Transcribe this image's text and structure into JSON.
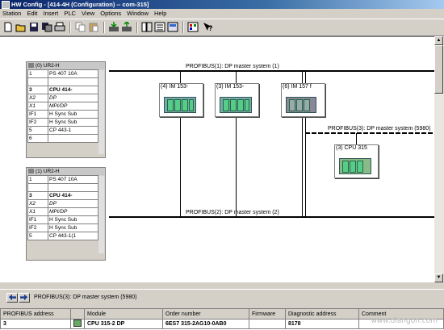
{
  "window": {
    "title": "HW Config - [414-4H (Configuration) -- com-315]"
  },
  "menu": [
    "Station",
    "Edit",
    "Insert",
    "PLC",
    "View",
    "Options",
    "Window",
    "Help"
  ],
  "toolbar_icons": [
    "new-icon",
    "open-icon",
    "save-icon",
    "save-compile-icon",
    "print-icon",
    "copy-icon",
    "paste-icon",
    "download-icon",
    "upload-icon",
    "catalog-icon",
    "network-icon",
    "settings-icon",
    "help-icon"
  ],
  "racks": [
    {
      "title": "(0) UR2-H",
      "rows": [
        {
          "slot": "1",
          "module": "PS 407 10A"
        },
        {
          "slot": "",
          "module": ""
        },
        {
          "slot": "3",
          "module": "CPU 414-"
        },
        {
          "slot": "X2",
          "module": "DP"
        },
        {
          "slot": "X1",
          "module": "MPI/DP"
        },
        {
          "slot": "IF1",
          "module": "H Sync Sub"
        },
        {
          "slot": "IF2",
          "module": "H Sync Sub"
        },
        {
          "slot": "5",
          "module": "CP 443-1"
        },
        {
          "slot": "6",
          "module": ""
        }
      ]
    },
    {
      "title": "(1) UR2-H",
      "rows": [
        {
          "slot": "1",
          "module": "PS 407 10A"
        },
        {
          "slot": "",
          "module": ""
        },
        {
          "slot": "3",
          "module": "CPU 414-"
        },
        {
          "slot": "X2",
          "module": "DP"
        },
        {
          "slot": "X1",
          "module": "MPI/DP"
        },
        {
          "slot": "IF1",
          "module": "H Sync Sub"
        },
        {
          "slot": "IF2",
          "module": "H Sync Sub"
        },
        {
          "slot": "5",
          "module": "CP 443-1(1"
        }
      ]
    }
  ],
  "networks": {
    "dp1": "PROFIBUS(1): DP master system (1)",
    "dp2": "PROFIBUS(2): DP master system (2)",
    "dp3": "PROFIBUS(3): DP master system (5980)"
  },
  "stations": {
    "im153_4": "(4) IM 153-",
    "im153_3": "(3) IM 153-",
    "im157": "(6) IM 157 f",
    "cpu315": "(3) CPU 315"
  },
  "infobar": {
    "text": "PROFIBUS(3): DP master system (5980)"
  },
  "table": {
    "headers": [
      "PROFIBUS address",
      "",
      "Module",
      "Order number",
      "Firmware",
      "Diagnostic address",
      "Comment"
    ],
    "rows": [
      [
        "3",
        "",
        "CPU 315-2 DP",
        "6ES7 315-2AG10-0AB0",
        "",
        "8178",
        ""
      ]
    ]
  },
  "watermark": "www.diangon.com"
}
